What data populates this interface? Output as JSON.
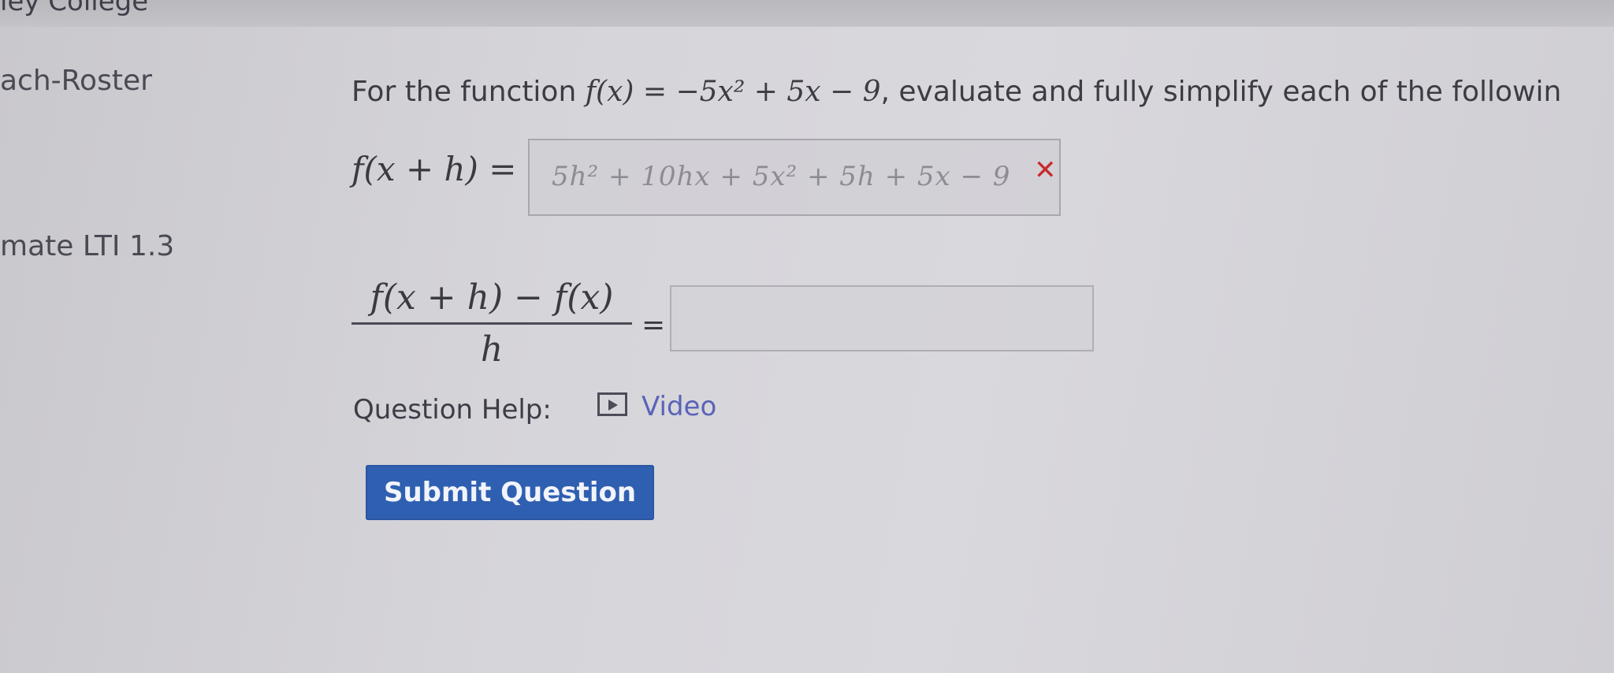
{
  "sidebar": {
    "college": "ley College",
    "roster": "ach-Roster",
    "lti": "mate LTI 1.3"
  },
  "question": {
    "prompt_prefix": "For the function ",
    "function_expr": "f(x) = −5x² + 5x − 9",
    "prompt_suffix": ", evaluate and fully simplify each of the followin",
    "part1_label": "f(x + h) =",
    "part1_answer": "5h² + 10hx + 5x² + 5h + 5x − 9",
    "part2_numerator": "f(x + h) − f(x)",
    "part2_denominator": "h",
    "part2_equals": "=",
    "part2_answer": ""
  },
  "help": {
    "label": "Question Help:",
    "video_label": "Video"
  },
  "buttons": {
    "submit_label": "Submit Question"
  },
  "colors": {
    "submit_bg": "#2f5fb0",
    "wrong_mark": "#c82a2a",
    "link": "#5a63b8"
  },
  "icons": {
    "wrong": "wrong-answer-icon",
    "video": "video-icon"
  }
}
